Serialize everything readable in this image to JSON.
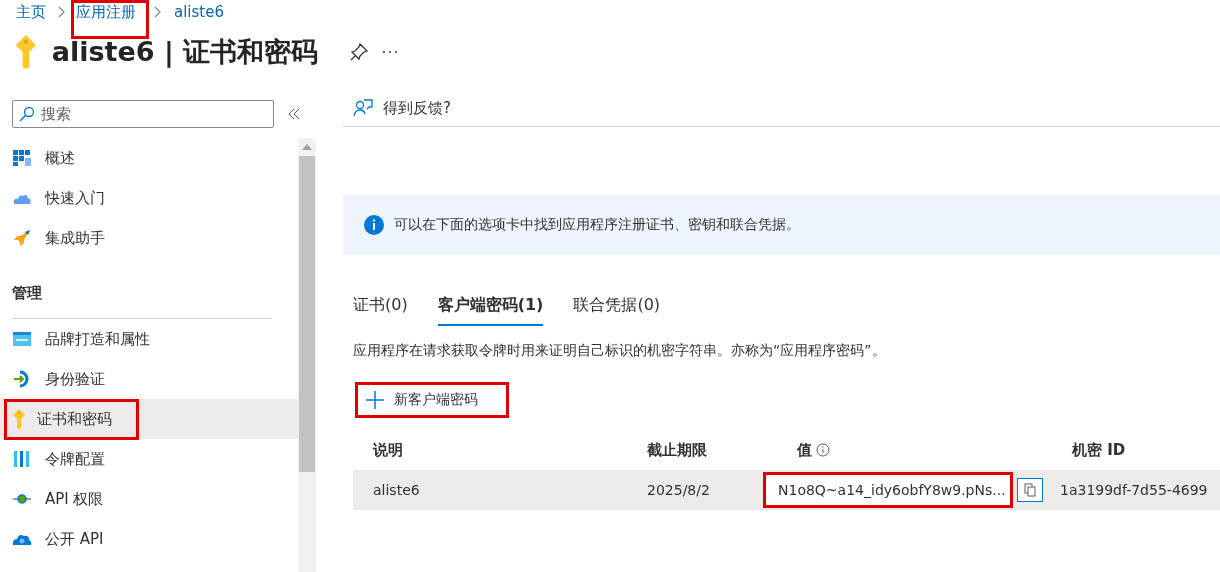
{
  "breadcrumb": [
    {
      "label": "主页",
      "highlighted": false
    },
    {
      "label": "应用注册",
      "highlighted": true
    },
    {
      "label": "aliste6",
      "highlighted": false
    }
  ],
  "page_title": "aliste6 | 证书和密码",
  "sidebar": {
    "search": {
      "placeholder": "搜索"
    },
    "groups": [
      {
        "items": [
          {
            "label": "概述",
            "selected": false,
            "highlighted": false
          },
          {
            "label": "快速入门",
            "selected": false,
            "highlighted": false
          },
          {
            "label": "集成助手",
            "selected": false,
            "highlighted": false
          }
        ]
      },
      {
        "heading": "管理",
        "items": [
          {
            "label": "品牌打造和属性",
            "selected": false,
            "highlighted": false
          },
          {
            "label": "身份验证",
            "selected": false,
            "highlighted": false
          },
          {
            "label": "证书和密码",
            "selected": true,
            "highlighted": true
          },
          {
            "label": "令牌配置",
            "selected": false,
            "highlighted": false
          },
          {
            "label": "API 权限",
            "selected": false,
            "highlighted": false
          },
          {
            "label": "公开 API",
            "selected": false,
            "highlighted": false
          }
        ]
      }
    ]
  },
  "feedback": "得到反馈?",
  "info_banner": "可以在下面的选项卡中找到应用程序注册证书、密钥和联合凭据。",
  "tabs": [
    {
      "label": "证书(0)",
      "selected": false
    },
    {
      "label": "客户端密码(1)",
      "selected": true
    },
    {
      "label": "联合凭据(0)",
      "selected": false
    }
  ],
  "description": "应用程序在请求获取令牌时用来证明自己标识的机密字符串。亦称为“应用程序密码”。",
  "new_button": {
    "label": "新客户端密码",
    "highlighted": true
  },
  "table": {
    "columns": [
      {
        "label": "说明",
        "info": false
      },
      {
        "label": "截止期限",
        "info": false
      },
      {
        "label": "值",
        "info": true
      },
      {
        "label": "机密 ID",
        "info": false
      }
    ],
    "rows": [
      {
        "cells": [
          {
            "text": "aliste6",
            "highlighted": false
          },
          {
            "text": "2025/8/2",
            "highlighted": false
          },
          {
            "text": "N1o8Q~a14_idy6obfY8w9.pNs...",
            "highlighted": true,
            "copy": true
          },
          {
            "text": "1a3199df-7d55-4699",
            "highlighted": false
          }
        ]
      }
    ]
  }
}
